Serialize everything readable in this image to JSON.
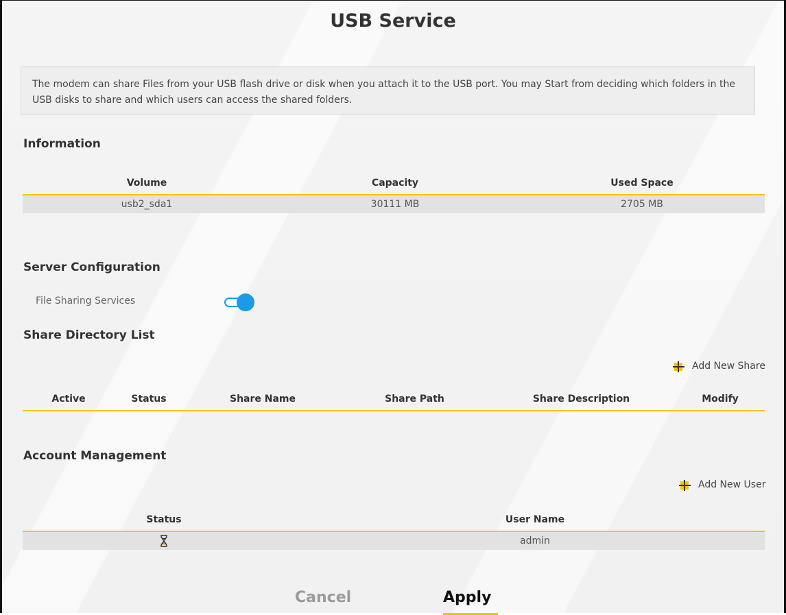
{
  "page": {
    "title": "USB Service"
  },
  "intro": {
    "text": "The modem can share Files from your USB flash drive or disk when you attach it to the USB port. You may Start from deciding which folders in the USB disks to share and which users can access the shared folders."
  },
  "information": {
    "heading": "Information",
    "columns": [
      "Volume",
      "Capacity",
      "Used Space"
    ],
    "rows": [
      {
        "volume": "usb2_sda1",
        "capacity": "30111 MB",
        "used_space": "2705 MB"
      }
    ]
  },
  "server_configuration": {
    "heading": "Server Configuration",
    "file_sharing_label": "File Sharing Services",
    "file_sharing_enabled": true,
    "toggle_color": "#1a9be8"
  },
  "share_directory": {
    "heading": "Share Directory List",
    "add_label": "Add New Share",
    "columns": [
      "Active",
      "Status",
      "Share Name",
      "Share Path",
      "Share Description",
      "Modify"
    ],
    "rows": []
  },
  "account_management": {
    "heading": "Account Management",
    "add_label": "Add New User",
    "columns": [
      "Status",
      "User Name"
    ],
    "rows": [
      {
        "status_icon": "hourglass-icon",
        "user_name": "admin"
      }
    ]
  },
  "actions": {
    "cancel_label": "Cancel",
    "apply_label": "Apply"
  },
  "colors": {
    "accent": "#f5c400",
    "toggle": "#1a9be8"
  }
}
